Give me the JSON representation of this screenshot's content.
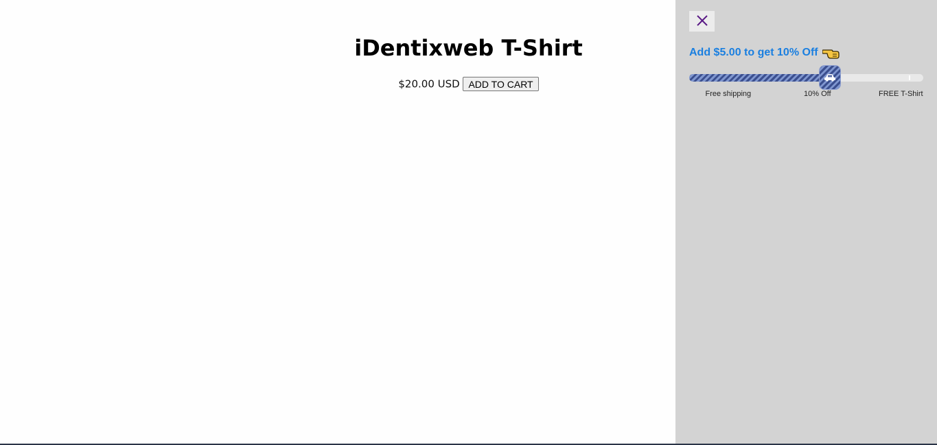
{
  "product": {
    "title": "iDentixweb T-Shirt",
    "price": "$20.00 USD",
    "add_to_cart_label": "ADD TO CART"
  },
  "drawer": {
    "close_icon": "close-icon",
    "goal_message": "Add $5.00 to get 10% Off",
    "goal_icon": "pointing-hand-icon",
    "progress_fraction": 0.6,
    "knob_icon": "car-icon",
    "milestones": [
      {
        "label": "Free shipping"
      },
      {
        "label": "10% Off"
      },
      {
        "label": "FREE T-Shirt"
      }
    ],
    "colors": {
      "panel_background": "#d3d3d3",
      "message_text": "#1a7fe0",
      "progress_fill": "#3b4f8f",
      "close_icon": "#5a1a86"
    }
  }
}
